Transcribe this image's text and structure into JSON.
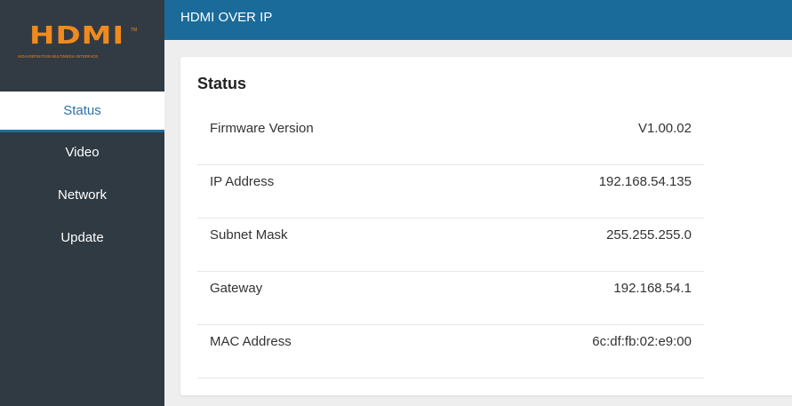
{
  "logo": {
    "text": "HDMI",
    "trademark": "TM",
    "subtitle": "HIGH-DEFINITION MULTIMEDIA INTERFACE"
  },
  "header": {
    "title": "HDMI OVER IP"
  },
  "sidebar": {
    "items": [
      {
        "label": "Status",
        "active": true
      },
      {
        "label": "Video",
        "active": false
      },
      {
        "label": "Network",
        "active": false
      },
      {
        "label": "Update",
        "active": false
      }
    ]
  },
  "status": {
    "title": "Status",
    "rows": [
      {
        "label": "Firmware Version",
        "value": "V1.00.02"
      },
      {
        "label": "IP Address",
        "value": "192.168.54.135"
      },
      {
        "label": "Subnet Mask",
        "value": "255.255.255.0"
      },
      {
        "label": "Gateway",
        "value": "192.168.54.1"
      },
      {
        "label": "MAC Address",
        "value": "6c:df:fb:02:e9:00"
      }
    ]
  },
  "colors": {
    "sidebar_bg": "#2f3a42",
    "header_bg": "#1a6b9a",
    "accent": "#2a72a8",
    "logo_orange": "#f08a1c"
  }
}
